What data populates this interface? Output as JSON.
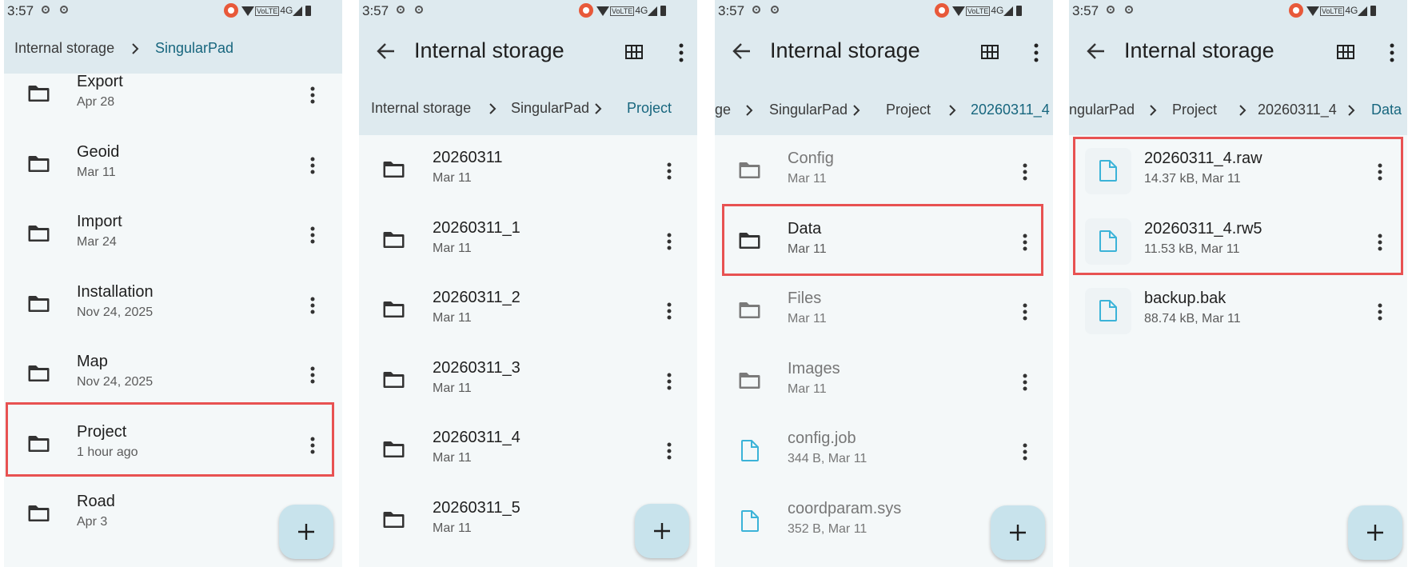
{
  "status": {
    "time": "3:57",
    "volte": "VoLTE",
    "network": "4G"
  },
  "screens": [
    {
      "breadcrumbs": [
        "Internal storage",
        "SingularPad"
      ],
      "items": [
        {
          "name": "Export",
          "meta": "Apr 28",
          "type": "folder"
        },
        {
          "name": "Geoid",
          "meta": "Mar 11",
          "type": "folder"
        },
        {
          "name": "Import",
          "meta": "Mar 24",
          "type": "folder"
        },
        {
          "name": "Installation",
          "meta": "Nov 24, 2025",
          "type": "folder"
        },
        {
          "name": "Map",
          "meta": "Nov 24, 2025",
          "type": "folder"
        },
        {
          "name": "Project",
          "meta": "1 hour ago",
          "type": "folder",
          "highlighted": true
        },
        {
          "name": "Road",
          "meta": "Apr 3",
          "type": "folder"
        }
      ],
      "fab_label": "+"
    },
    {
      "title": "Internal storage",
      "breadcrumbs": [
        "Internal storage",
        "SingularPad",
        "Project"
      ],
      "items": [
        {
          "name": "20260311",
          "meta": "Mar 11",
          "type": "folder"
        },
        {
          "name": "20260311_1",
          "meta": "Mar 11",
          "type": "folder"
        },
        {
          "name": "20260311_2",
          "meta": "Mar 11",
          "type": "folder"
        },
        {
          "name": "20260311_3",
          "meta": "Mar 11",
          "type": "folder"
        },
        {
          "name": "20260311_4",
          "meta": "Mar 11",
          "type": "folder"
        },
        {
          "name": "20260311_5",
          "meta": "Mar 11",
          "type": "folder"
        }
      ],
      "fab_label": "+"
    },
    {
      "title": "Internal storage",
      "breadcrumbs": [
        "ge",
        "SingularPad",
        "Project",
        "20260311_4"
      ],
      "items": [
        {
          "name": "Config",
          "meta": "Mar 11",
          "type": "folder"
        },
        {
          "name": "Data",
          "meta": "Mar 11",
          "type": "folder",
          "highlighted": true
        },
        {
          "name": "Files",
          "meta": "Mar 11",
          "type": "folder"
        },
        {
          "name": "Images",
          "meta": "Mar 11",
          "type": "folder"
        },
        {
          "name": "config.job",
          "meta": "344 B, Mar 11",
          "type": "file"
        },
        {
          "name": "coordparam.sys",
          "meta": "352 B, Mar 11",
          "type": "file"
        }
      ],
      "fab_label": "+"
    },
    {
      "title": "Internal storage",
      "breadcrumbs": [
        "ngularPad",
        "Project",
        "20260311_4",
        "Data"
      ],
      "items": [
        {
          "name": "20260311_4.raw",
          "meta": "14.37 kB, Mar 11",
          "type": "file"
        },
        {
          "name": "20260311_4.rw5",
          "meta": "11.53 kB, Mar 11",
          "type": "file"
        },
        {
          "name": "backup.bak",
          "meta": "88.74 kB, Mar 11",
          "type": "file"
        }
      ],
      "fab_label": "+"
    }
  ],
  "colors": {
    "header": "#deeaef",
    "accent": "#17667e",
    "highlight": "#e85252",
    "file_icon": "#3bb3d8",
    "fab": "#c8e3ec"
  }
}
